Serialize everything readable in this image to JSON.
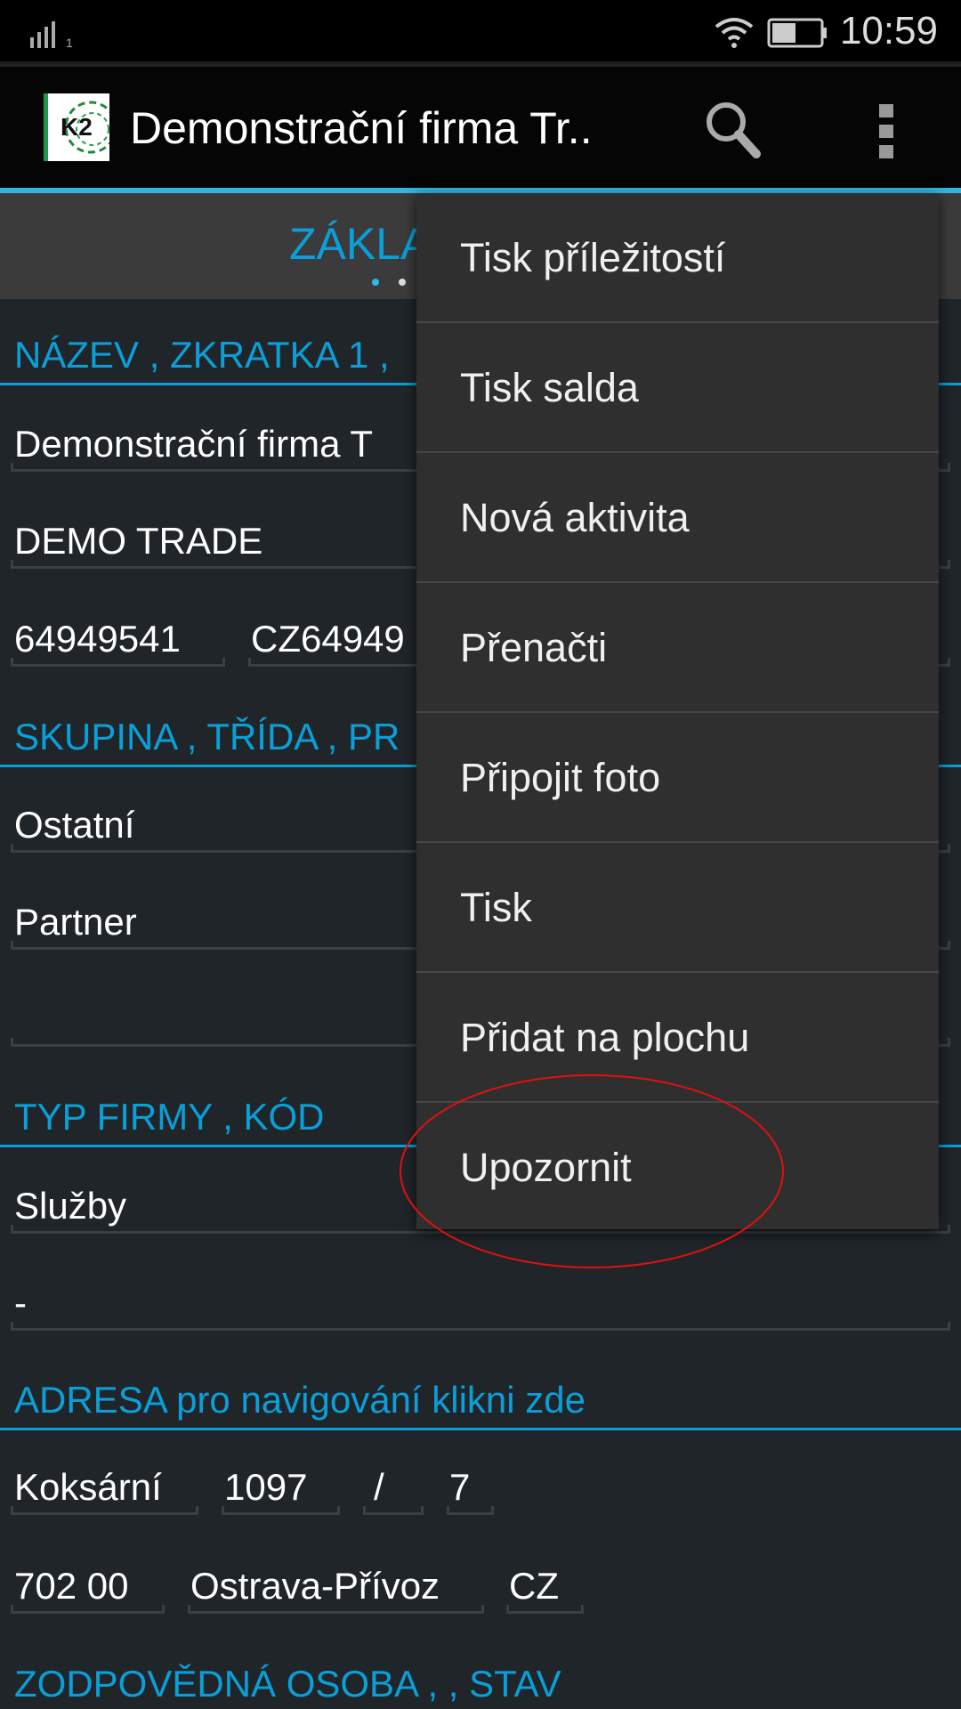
{
  "status_bar": {
    "time": "10:59",
    "signal_sim": "1"
  },
  "action_bar": {
    "title": "Demonstrační firma Tr..",
    "logo_text": "K2",
    "search_icon": "search-icon",
    "overflow_icon": "more-vert-icon"
  },
  "tab": {
    "title": "ZÁKLA"
  },
  "sections": {
    "nazev": {
      "header": "NÁZEV , ZKRATKA 1 ,",
      "name": "Demonstrační firma T",
      "short": "DEMO TRADE",
      "ico": "64949541",
      "dic": "CZ64949"
    },
    "skupina": {
      "header": "SKUPINA , TŘÍDA , PR",
      "group": "Ostatní",
      "class": "Partner",
      "third": ""
    },
    "typ": {
      "header": "TYP FIRMY , KÓD",
      "type": "Služby",
      "code": "-"
    },
    "adresa": {
      "header": "ADRESA pro navigování klikni zde",
      "street": "Koksární",
      "number": "1097",
      "slash": "/",
      "orient": "7",
      "zip": "702 00",
      "city": "Ostrava-Přívoz",
      "country": "CZ"
    },
    "zodp": {
      "header": "ZODPOVĚDNÁ OSOBA ,  , STAV"
    }
  },
  "menu": {
    "items": [
      "Tisk příležitostí",
      "Tisk salda",
      "Nová aktivita",
      "Přenačti",
      "Připojit foto",
      "Tisk",
      "Přidat na plochu",
      "Upozornit"
    ]
  },
  "annotation": {
    "color": "#e01010",
    "highlighted_item": "Upozornit"
  },
  "colors": {
    "accent": "#0a9fd8",
    "highlight": "#33b5e5"
  }
}
